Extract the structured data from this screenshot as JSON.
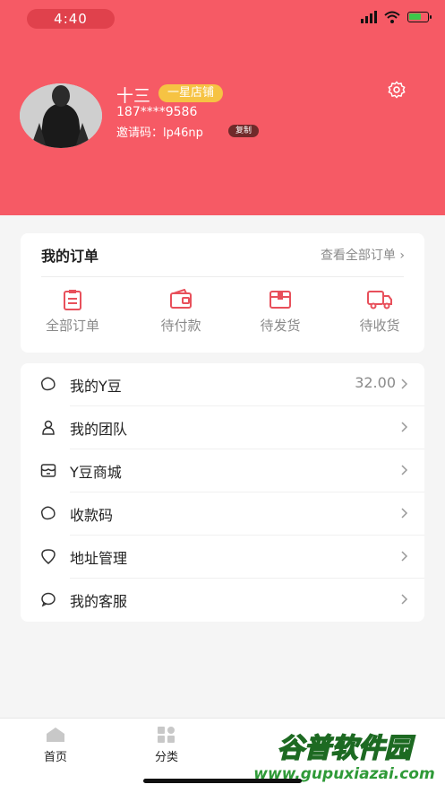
{
  "status_bar": {
    "time": "4:40"
  },
  "profile": {
    "name": "十三",
    "badge": "一星店铺",
    "phone": "187****9586",
    "invite_code": "邀请码：lp46np",
    "copy_label": "复制"
  },
  "orders": {
    "title": "我的订单",
    "view_all": "查看全部订单",
    "items": [
      {
        "label": "全部订单",
        "icon": "all-orders-icon"
      },
      {
        "label": "待付款",
        "icon": "wallet-icon"
      },
      {
        "label": "待发货",
        "icon": "package-icon"
      },
      {
        "label": "待收货",
        "icon": "truck-icon"
      }
    ]
  },
  "menu": [
    {
      "label": "我的Y豆",
      "value": "32.00",
      "icon": "bean-icon"
    },
    {
      "label": "我的团队",
      "value": "",
      "icon": "person-icon"
    },
    {
      "label": "Y豆商城",
      "value": "",
      "icon": "store-icon"
    },
    {
      "label": "收款码",
      "value": "",
      "icon": "bean-icon"
    },
    {
      "label": "地址管理",
      "value": "",
      "icon": "location-icon"
    },
    {
      "label": "我的客服",
      "value": "",
      "icon": "chat-icon"
    }
  ],
  "tabbar": [
    {
      "label": "首页",
      "icon": "home-icon"
    },
    {
      "label": "分类",
      "icon": "category-icon"
    }
  ],
  "watermark": {
    "text": "谷普软件园",
    "url": "www.gupuxiazai.com"
  },
  "colors": {
    "header": "#f65a65",
    "accent": "#e8505b",
    "badge": "#f6c343"
  }
}
